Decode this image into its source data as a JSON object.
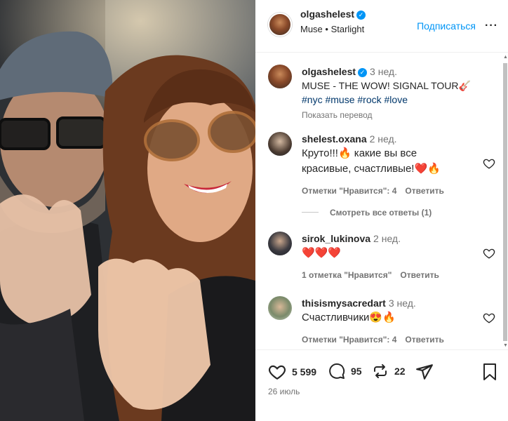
{
  "post": {
    "author": "olgashelest",
    "music": "Muse • Starlight",
    "follow_label": "Подписаться",
    "more_icon": "···",
    "caption_time": "3 нед.",
    "caption_text": "MUSE - THE WOW! SIGNAL TOUR🎸",
    "hashtags": [
      "#nyc",
      "#muse",
      "#rock",
      "#love"
    ],
    "translate": "Показать перевод"
  },
  "comments": [
    {
      "user": "shelest.oxana",
      "time": "2 нед.",
      "text": "Круто!!!🔥 какие вы все красивые, счастливые!❤️🔥",
      "likes": "Отметки \"Нравится\": 4",
      "reply": "Ответить"
    },
    {
      "user": "sirok_lukinova",
      "time": "2 нед.",
      "text": "❤️❤️❤️",
      "likes": "1 отметка \"Нравится\"",
      "reply": "Ответить"
    },
    {
      "user": "thisismysacredart",
      "time": "3 нед.",
      "text": "Счастливчики😍🔥",
      "likes": "Отметки \"Нравится\": 4",
      "reply": "Ответить"
    }
  ],
  "view_replies": "Смотреть все ответы (1)",
  "actions": {
    "likes": "5 599",
    "comments": "95",
    "reposts": "22",
    "date": "26 июль"
  },
  "colors": {
    "link": "#0095f6",
    "hashtag": "#00376b",
    "muted": "#737373"
  }
}
